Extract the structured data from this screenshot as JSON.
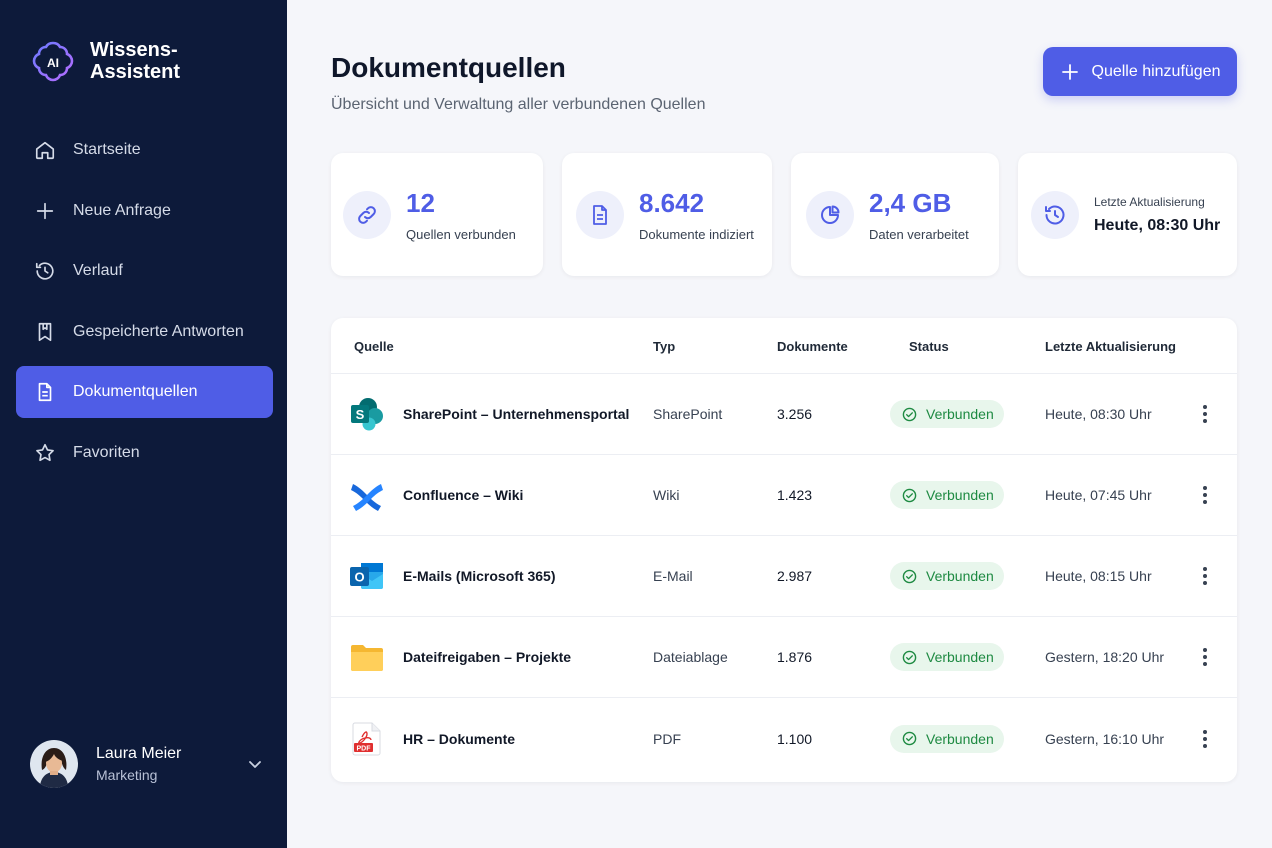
{
  "brand": {
    "name": "Wissens-Assistent",
    "logo_text": "AI"
  },
  "nav": {
    "items": [
      {
        "label": "Startseite",
        "icon": "home-icon"
      },
      {
        "label": "Neue Anfrage",
        "icon": "plus-icon"
      },
      {
        "label": "Verlauf",
        "icon": "history-icon"
      },
      {
        "label": "Gespeicherte Antworten",
        "icon": "bookmark-icon"
      },
      {
        "label": "Dokumentquellen",
        "icon": "document-icon",
        "active": true
      },
      {
        "label": "Favoriten",
        "icon": "star-icon"
      }
    ]
  },
  "user": {
    "name": "Laura Meier",
    "role": "Marketing"
  },
  "header": {
    "title": "Dokumentquellen",
    "subtitle": "Übersicht und Verwaltung aller verbundenen Quellen",
    "add_button": "Quelle hinzufügen"
  },
  "stats": [
    {
      "value": "12",
      "label": "Quellen verbunden",
      "icon": "link-icon"
    },
    {
      "value": "8.642",
      "label": "Dokumente indiziert",
      "icon": "document-icon"
    },
    {
      "value": "2,4 GB",
      "label": "Daten verarbeitet",
      "icon": "pie-chart-icon"
    },
    {
      "label": "Letzte Aktualisierung",
      "value": "Heute, 08:30 Uhr",
      "icon": "history-icon"
    }
  ],
  "table": {
    "columns": [
      "Quelle",
      "Typ",
      "Dokumente",
      "Status",
      "Letzte Aktualisierung"
    ],
    "rows": [
      {
        "name": "SharePoint – Unternehmensportal",
        "type": "SharePoint",
        "documents": "3.256",
        "status": "Verbunden",
        "updated": "Heute, 08:30 Uhr",
        "icon": "sharepoint-icon"
      },
      {
        "name": "Confluence – Wiki",
        "type": "Wiki",
        "documents": "1.423",
        "status": "Verbunden",
        "updated": "Heute, 07:45 Uhr",
        "icon": "confluence-icon"
      },
      {
        "name": "E-Mails (Microsoft 365)",
        "type": "E-Mail",
        "documents": "2.987",
        "status": "Verbunden",
        "updated": "Heute, 08:15 Uhr",
        "icon": "outlook-icon"
      },
      {
        "name": "Dateifreigaben – Projekte",
        "type": "Dateiablage",
        "documents": "1.876",
        "status": "Verbunden",
        "updated": "Gestern, 18:20 Uhr",
        "icon": "folder-icon"
      },
      {
        "name": "HR – Dokumente",
        "type": "PDF",
        "documents": "1.100",
        "status": "Verbunden",
        "updated": "Gestern, 16:10 Uhr",
        "icon": "pdf-icon",
        "icon_text": "PDF"
      }
    ]
  },
  "colors": {
    "sidebar": "#0d1a3a",
    "accent": "#4f5de6",
    "success": "#1e8a42",
    "success_bg": "#e8f6ec"
  }
}
